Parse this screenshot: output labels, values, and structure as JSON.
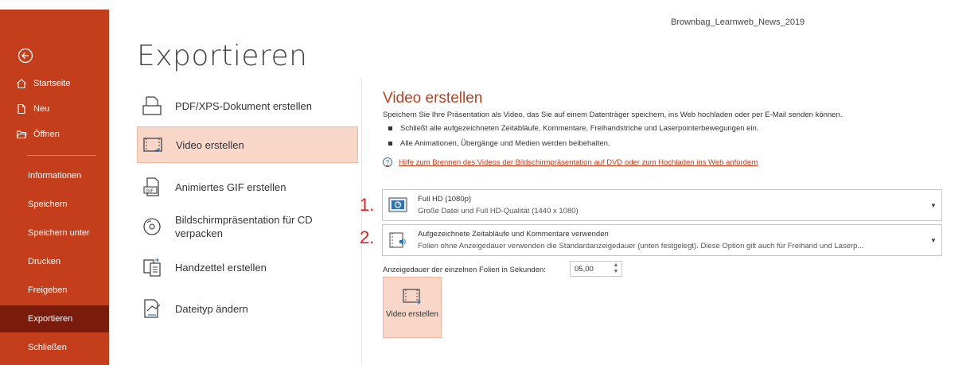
{
  "document_name": "Brownbag_Learnweb_News_2019",
  "page_title": "Exportieren",
  "nav": {
    "top": [
      {
        "label": "Startseite"
      },
      {
        "label": "Neu"
      },
      {
        "label": "Öffnen"
      }
    ],
    "sub": [
      {
        "label": "Informationen"
      },
      {
        "label": "Speichern"
      },
      {
        "label": "Speichern unter"
      },
      {
        "label": "Drucken"
      },
      {
        "label": "Freigeben"
      },
      {
        "label": "Exportieren"
      },
      {
        "label": "Schließen"
      }
    ]
  },
  "options": [
    {
      "label": "PDF/XPS-Dokument erstellen"
    },
    {
      "label": "Video erstellen"
    },
    {
      "label": "Animiertes GIF erstellen"
    },
    {
      "label": "Bildschirmpräsentation für CD verpacken"
    },
    {
      "label": "Handzettel erstellen"
    },
    {
      "label": "Dateityp ändern"
    }
  ],
  "detail": {
    "title": "Video erstellen",
    "description": "Speichern Sie Ihre Präsentation als Video, das Sie auf einem Datenträger speichern, ins Web hochladen oder per E-Mail senden können.",
    "bullets": [
      "Schließt alle aufgezeichneten Zeitabläufe, Kommentare, Freihandstriche und Laserpointerbewegungen ein.",
      "Alle Animationen, Übergänge und Medien werden beibehalten."
    ],
    "help_link": "Hilfe zum Brennen des Videos der Bildschirmpräsentation auf DVD oder zum Hochladen ins Web anfordern",
    "markers": [
      "1.",
      "2."
    ],
    "quality": {
      "title": "Full HD (1080p)",
      "subtitle": "Große Datei und Full HD-Qualität (1440 x 1080)"
    },
    "timing": {
      "title": "Aufgezeichnete Zeitabläufe und Kommentare verwenden",
      "subtitle": "Folien ohne Anzeigedauer verwenden die Standardanzeigedauer (unten festgelegt). Diese Option gilt auch für Freihand und Laserp..."
    },
    "duration_label": "Anzeigedauer der einzelnen Folien in Sekunden:",
    "duration_value": "05,00",
    "create_button": "Video erstellen"
  },
  "colors": {
    "accent": "#c43e1c",
    "accent_dark": "#7a1c0b",
    "selection_fill": "#f8d6c8",
    "marker_red": "#e02020"
  }
}
